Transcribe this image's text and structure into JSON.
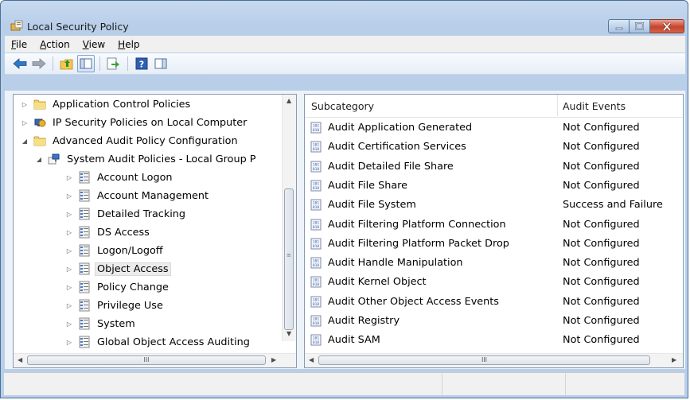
{
  "window": {
    "title": "Local Security Policy"
  },
  "menu": [
    {
      "key": "F",
      "rest": "ile"
    },
    {
      "key": "A",
      "rest": "ction"
    },
    {
      "key": "V",
      "rest": "iew"
    },
    {
      "key": "H",
      "rest": "elp"
    }
  ],
  "tree": {
    "items": [
      {
        "label": "Application Control Policies"
      },
      {
        "label": "IP Security Policies on Local Computer"
      },
      {
        "label": "Advanced Audit Policy Configuration"
      },
      {
        "label": "System Audit Policies - Local Group P"
      },
      {
        "label": "Account Logon"
      },
      {
        "label": "Account Management"
      },
      {
        "label": "Detailed Tracking"
      },
      {
        "label": "DS Access"
      },
      {
        "label": "Logon/Logoff"
      },
      {
        "label": "Object Access"
      },
      {
        "label": "Policy Change"
      },
      {
        "label": "Privilege Use"
      },
      {
        "label": "System"
      },
      {
        "label": "Global Object Access Auditing"
      }
    ],
    "selected": "Object Access"
  },
  "list": {
    "columns": [
      "Subcategory",
      "Audit Events"
    ],
    "rows": [
      {
        "name": "Audit Application Generated",
        "value": "Not Configured"
      },
      {
        "name": "Audit Certification Services",
        "value": "Not Configured"
      },
      {
        "name": "Audit Detailed File Share",
        "value": "Not Configured"
      },
      {
        "name": "Audit File Share",
        "value": "Not Configured"
      },
      {
        "name": "Audit File System",
        "value": "Success and Failure"
      },
      {
        "name": "Audit Filtering Platform Connection",
        "value": "Not Configured"
      },
      {
        "name": "Audit Filtering Platform Packet Drop",
        "value": "Not Configured"
      },
      {
        "name": "Audit Handle Manipulation",
        "value": "Not Configured"
      },
      {
        "name": "Audit Kernel Object",
        "value": "Not Configured"
      },
      {
        "name": "Audit Other Object Access Events",
        "value": "Not Configured"
      },
      {
        "name": "Audit Registry",
        "value": "Not Configured"
      },
      {
        "name": "Audit SAM",
        "value": "Not Configured"
      }
    ]
  },
  "scroll": {
    "thumb_glyph": "III"
  }
}
